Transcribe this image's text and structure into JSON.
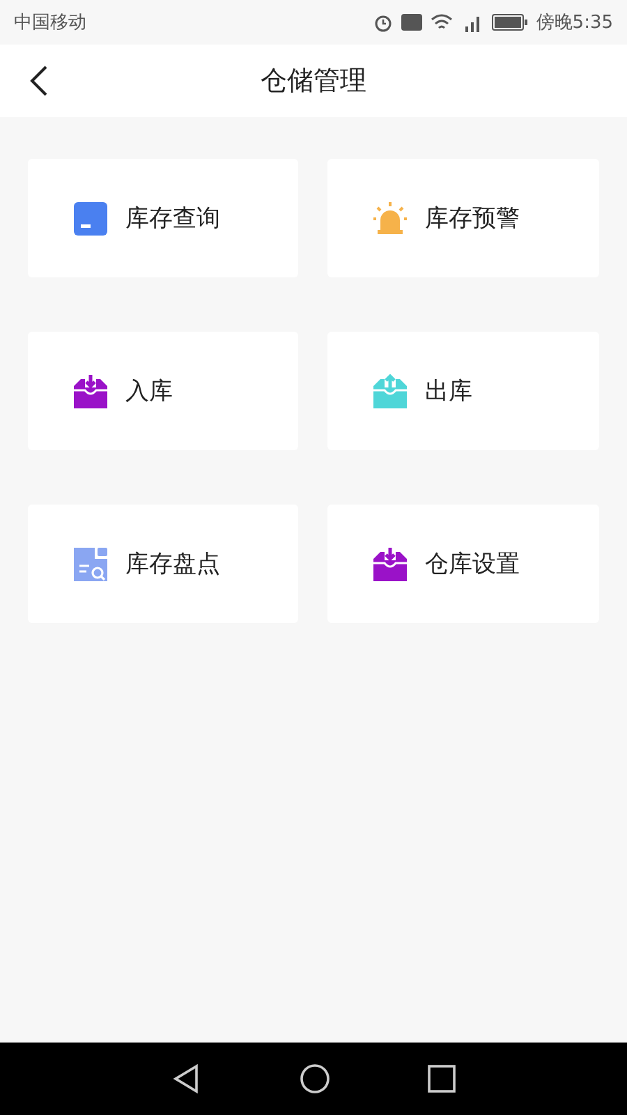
{
  "status_bar": {
    "carrier": "中国移动",
    "time": "傍晚5:35"
  },
  "header": {
    "title": "仓储管理"
  },
  "tiles": [
    {
      "label": "库存查询",
      "kind": "box",
      "color": "#4a80f0"
    },
    {
      "label": "库存预警",
      "kind": "alarm",
      "color": "#f6b24a"
    },
    {
      "label": "入库",
      "kind": "inbox-in",
      "color": "#9a12c8"
    },
    {
      "label": "出库",
      "kind": "inbox-out",
      "color": "#4fd6d8"
    },
    {
      "label": "库存盘点",
      "kind": "doc-search",
      "color": "#8aa6f2"
    },
    {
      "label": "仓库设置",
      "kind": "inbox-in",
      "color": "#9a12c8"
    }
  ]
}
